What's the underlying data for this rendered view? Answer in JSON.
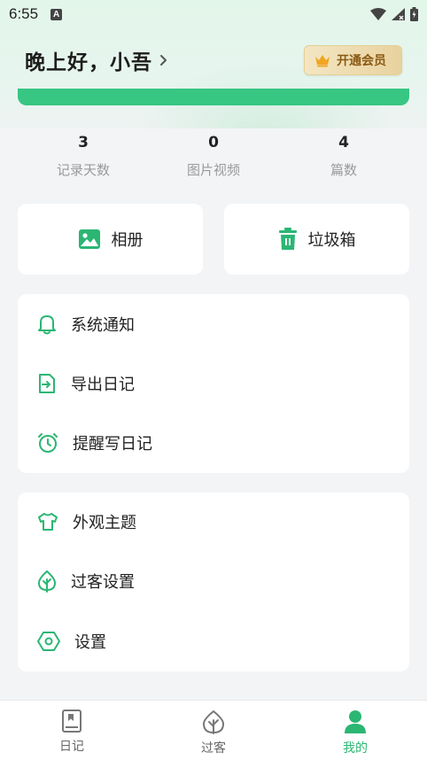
{
  "status_bar": {
    "time": "6:55",
    "notification_letter": "A"
  },
  "header": {
    "greeting": "晚上好，小吾",
    "vip_button_label": "开通会员"
  },
  "stats": [
    {
      "value": "3",
      "label": "记录天数"
    },
    {
      "value": "0",
      "label": "图片视频"
    },
    {
      "value": "4",
      "label": "篇数"
    }
  ],
  "quick_actions": {
    "album": "相册",
    "trash": "垃圾箱"
  },
  "menu_group_1": {
    "notifications": "系统通知",
    "export_diary": "导出日记",
    "reminder": "提醒写日记"
  },
  "menu_group_2": {
    "theme": "外观主题",
    "guest_settings": "过客设置",
    "settings": "设置"
  },
  "tabbar": {
    "diary": "日记",
    "guest": "过客",
    "mine": "我的"
  },
  "colors": {
    "accent": "#2bb673",
    "banner_green": "#38c683",
    "vip_gold": "#e8d29e"
  }
}
